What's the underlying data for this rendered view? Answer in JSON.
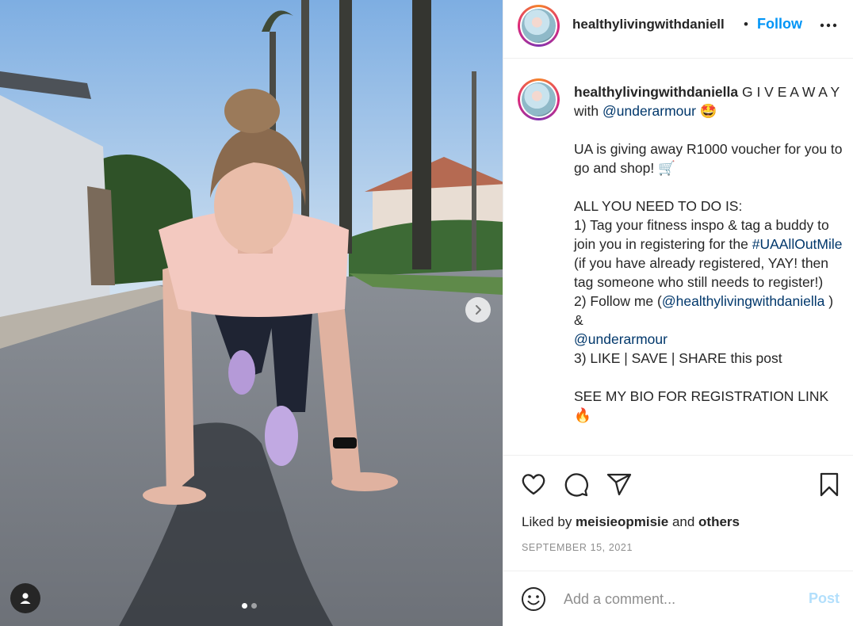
{
  "colors": {
    "accent": "#0095f6",
    "link": "#00376b",
    "muted": "#8e8e8e",
    "post_disabled": "#b2dffc"
  },
  "post": {
    "username": "healthylivingwithdaniell",
    "separator": "•",
    "follow_label": "Follow",
    "more_icon": "more-horizontal-icon"
  },
  "caption": {
    "username": "healthylivingwithdaniella",
    "line1_text": " G I V E A W A Y with ",
    "line1_mention": "@underarmour",
    "line1_emoji": " 🤩",
    "para2": "UA is giving away R1000 voucher for you to go and shop! 🛒",
    "para3_a": "ALL YOU NEED TO DO IS:\n1) Tag your fitness inspo & tag a buddy to join you in registering for the ",
    "hashtag": "#UAAllOutMile",
    "para3_b": " (if you have already registered, YAY! then tag someone who still needs to register!)\n2) Follow me (",
    "mention_self": "@healthylivingwithdaniella",
    "para3_c": " ) &\n",
    "mention_ua": "@underarmour",
    "para3_d": "\n3) LIKE | SAVE | SHARE this post",
    "para4": "SEE MY BIO FOR REGISTRATION LINK 🔥"
  },
  "actions": {
    "like_icon": "heart-icon",
    "comment_icon": "comment-icon",
    "share_icon": "share-icon",
    "save_icon": "bookmark-icon"
  },
  "likes": {
    "prefix": "Liked by ",
    "user": "meisieopmisie",
    "middle": " and ",
    "others": "others"
  },
  "date": "SEPTEMBER 15, 2021",
  "comment": {
    "placeholder": "Add a comment...",
    "post_label": "Post"
  },
  "carousel": {
    "current": 1,
    "total": 2
  }
}
